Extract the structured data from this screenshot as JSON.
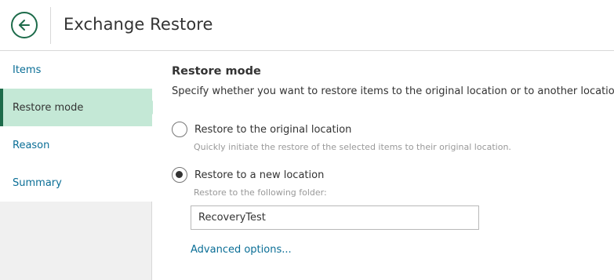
{
  "header": {
    "title": "Exchange Restore",
    "back_icon": "arrow-left-icon",
    "accent_color": "#1d6b4a"
  },
  "sidebar": {
    "items": [
      {
        "label": "Items",
        "active": false
      },
      {
        "label": "Restore mode",
        "active": true
      },
      {
        "label": "Reason",
        "active": false
      },
      {
        "label": "Summary",
        "active": false
      }
    ],
    "active_color": "#c4e8d6",
    "link_color": "#0a6e96"
  },
  "main": {
    "section_title": "Restore mode",
    "description": "Specify whether you want to restore items to the original location or to another location.",
    "options": [
      {
        "label": "Restore to the original location",
        "hint": "Quickly initiate the restore of the selected items to their original location.",
        "selected": false
      },
      {
        "label": "Restore to a new location",
        "hint": "Restore to the following folder:",
        "selected": true
      }
    ],
    "folder_value": "RecoveryTest",
    "advanced_link": "Advanced options..."
  }
}
